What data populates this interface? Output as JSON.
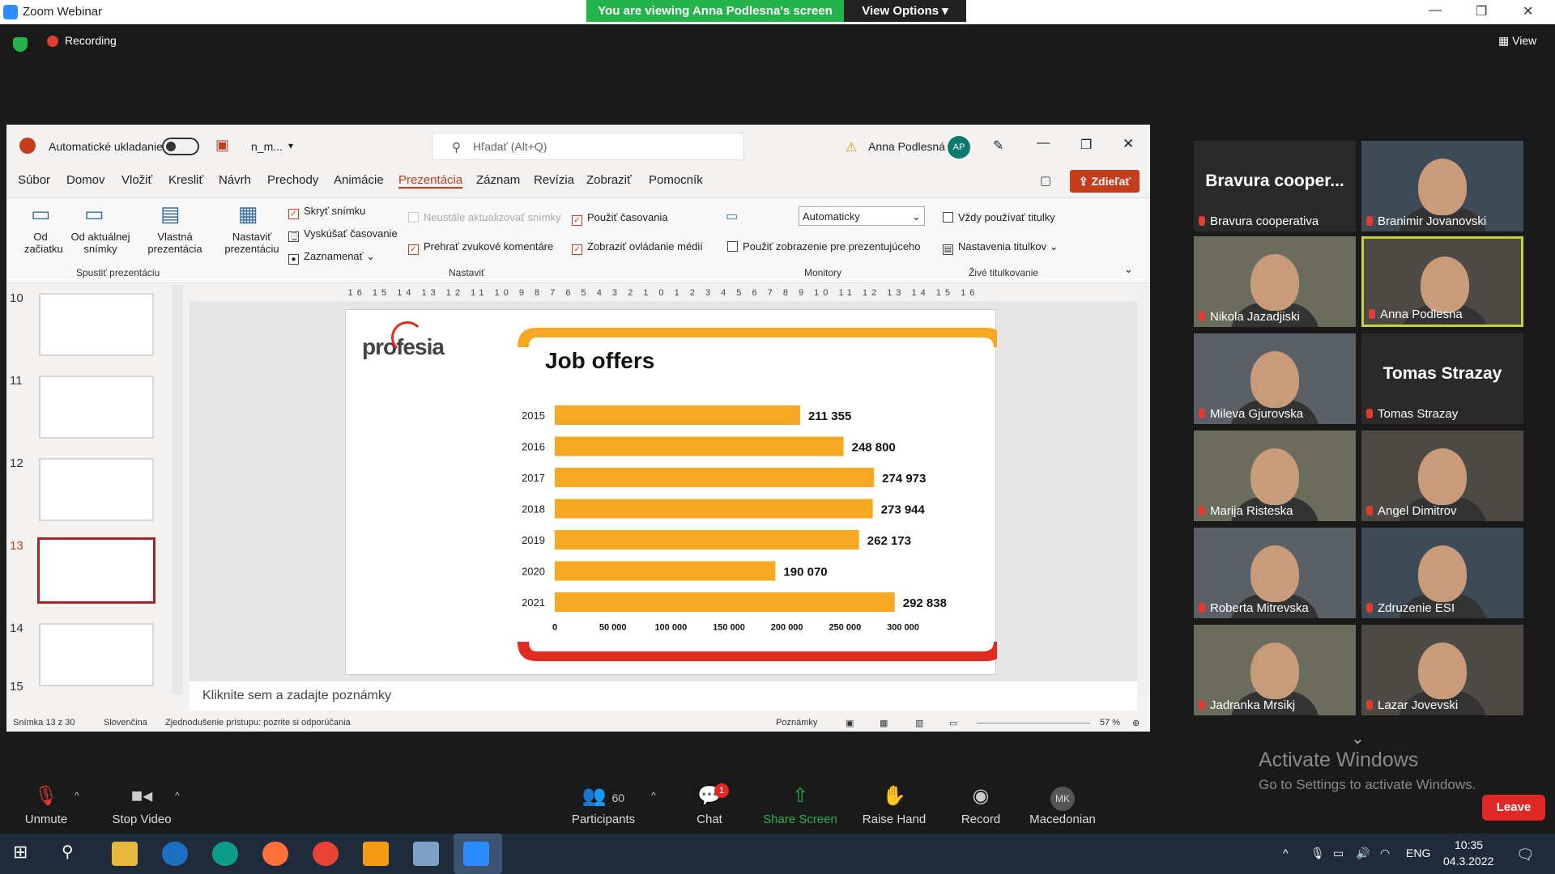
{
  "zoom": {
    "app_title": "Zoom Webinar",
    "viewing_banner": "You are viewing Anna Podlesna's screen",
    "view_options": "View Options",
    "recording_label": "Recording",
    "view_label": "View"
  },
  "ppt": {
    "autosave_label": "Automatické ukladanie",
    "filename": "n_m...",
    "search_placeholder": "Hľadať (Alt+Q)",
    "user_name": "Anna Podlesná",
    "user_initials": "AP",
    "menu": [
      "Súbor",
      "Domov",
      "Vložiť",
      "Kresliť",
      "Návrh",
      "Prechody",
      "Animácie",
      "Prezentácia",
      "Záznam",
      "Revízia",
      "Zobraziť",
      "Pomocník"
    ],
    "share_label": "Zdieľať",
    "ribbon": {
      "from_start": "Od začiatku",
      "from_current": "Od aktuálnej snímky",
      "custom_show": "Vlastná prezentácia",
      "group_start": "Spustiť prezentáciu",
      "setup_show": "Nastaviť prezentáciu",
      "hide_slide": "Skryť snímku",
      "rehearse": "Vyskúšať časovanie",
      "record": "Zaznamenať",
      "keep_updated": "Neustále aktualizovať snímky",
      "play_narrations": "Prehrať zvukové komentáre",
      "use_timings": "Použiť časovania",
      "show_media": "Zobraziť ovládanie médií",
      "group_setup": "Nastaviť",
      "monitor_value": "Automaticky",
      "presenter_view": "Použiť zobrazenie pre prezentujúceho",
      "group_monitors": "Monitory",
      "always_subtitles": "Vždy používať titulky",
      "subtitle_settings": "Nastavenia titulkov",
      "group_captions": "Živé titulkovanie"
    },
    "thumb_numbers": [
      "10",
      "11",
      "12",
      "13",
      "14",
      "15"
    ],
    "ruler": "16 15 14 13 12 11 10 9 8 7 6 5 4 3 2 1 0 1 2 3 4 5 6 7 8 9 10 11 12 13 14 15 16",
    "notes_placeholder": "Kliknite sem a zadajte poznámky",
    "status": {
      "slide": "Snímka 13 z 30",
      "language": "Slovenčina",
      "accessibility": "Zjednodušenie prístupu: pozrite si odporúčania",
      "notes": "Poznámky",
      "zoom": "57 %"
    }
  },
  "slide": {
    "brand": "profesia",
    "title": "Job offers"
  },
  "chart_data": {
    "type": "bar",
    "title": "Job offers",
    "categories": [
      "2015",
      "2016",
      "2017",
      "2018",
      "2019",
      "2020",
      "2021"
    ],
    "values": [
      211355,
      248800,
      274973,
      273944,
      262173,
      190070,
      292838
    ],
    "value_labels": [
      "211 355",
      "248 800",
      "274 973",
      "273 944",
      "262 173",
      "190 070",
      "292 838"
    ],
    "xticks": [
      "0",
      "50 000",
      "100 000",
      "150 000",
      "200 000",
      "250 000",
      "300 000"
    ],
    "xlim": [
      0,
      300000
    ],
    "bar_color": "#f7a823",
    "xlabel": "",
    "ylabel": ""
  },
  "participants": [
    {
      "name": "Bravura cooperativa",
      "big": "Bravura cooper...",
      "video": false
    },
    {
      "name": "Branimir Jovanovski",
      "video": true
    },
    {
      "name": "Nikola Jazadjiski",
      "video": true
    },
    {
      "name": "Anna Podlesna",
      "video": true,
      "active": true
    },
    {
      "name": "Mileva Gjurovska",
      "video": true
    },
    {
      "name": "Tomas Strazay",
      "big": "Tomas Strazay",
      "video": false
    },
    {
      "name": "Marija Risteska",
      "video": true
    },
    {
      "name": "Angel Dimitrov",
      "video": true
    },
    {
      "name": "Roberta Mitrevska",
      "video": true
    },
    {
      "name": "Zdruzenie ESI",
      "video": true
    },
    {
      "name": "Jadranka Mrsikj",
      "video": true
    },
    {
      "name": "Lazar Jovevski",
      "video": true
    }
  ],
  "activate": {
    "line1": "Activate Windows",
    "line2": "Go to Settings to activate Windows."
  },
  "toolbar": {
    "unmute": "Unmute",
    "stop_video": "Stop Video",
    "participants": "Participants",
    "participants_count": "60",
    "chat": "Chat",
    "chat_badge": "1",
    "share_screen": "Share Screen",
    "raise_hand": "Raise Hand",
    "record": "Record",
    "language": "Macedonian",
    "language_initials": "MK",
    "leave": "Leave"
  },
  "taskbar": {
    "lang": "ENG",
    "time": "10:35",
    "date": "04.3.2022"
  },
  "colors": {
    "zoom_green": "#25b34b",
    "ppt_accent": "#c43e1c",
    "leave_red": "#e02828"
  }
}
